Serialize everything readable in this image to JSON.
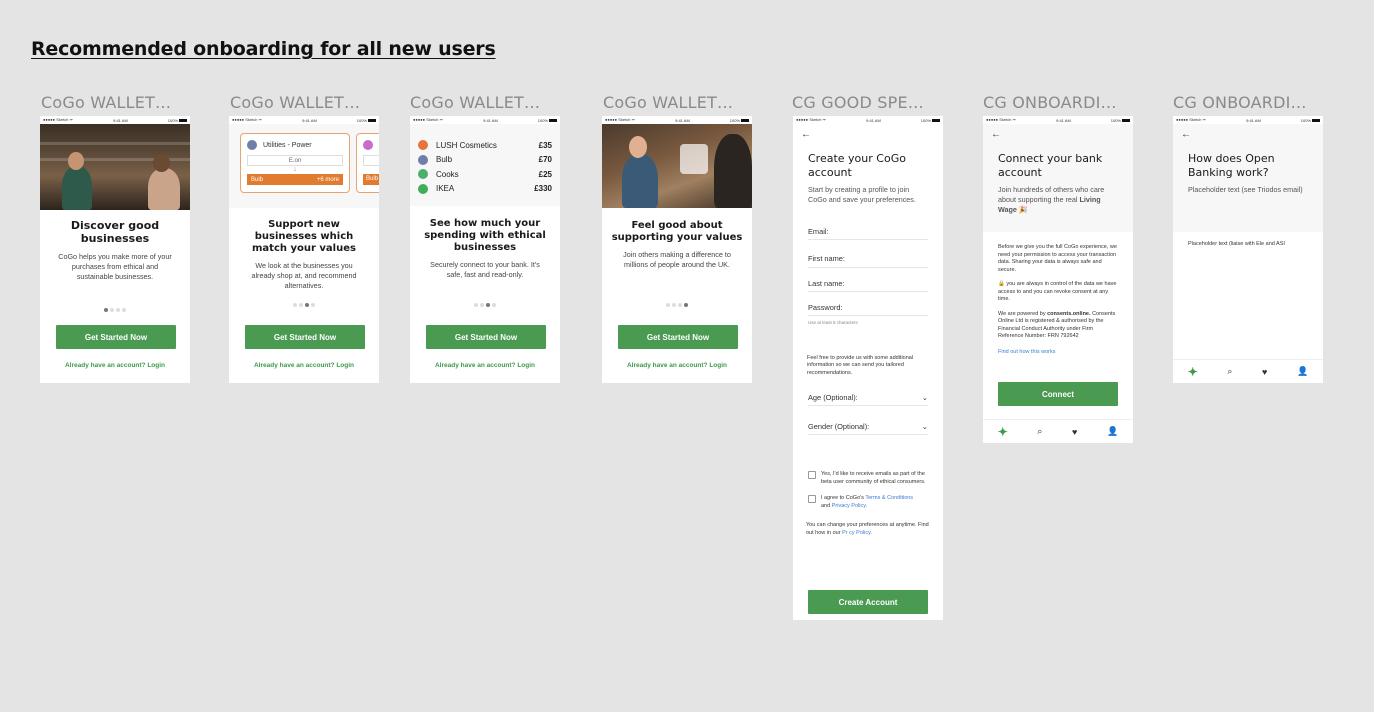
{
  "page_title": "Recommended onboarding for all new users",
  "status": {
    "carrier": "●●●●● Sketch ᯤ",
    "time": "9:41 AM",
    "battery": "100%"
  },
  "common": {
    "cta": "Get Started Now",
    "login": "Already have an account? Login"
  },
  "screens": [
    {
      "label": "CoGo WALLET…",
      "title": "Discover good businesses",
      "body": "CoGo helps you make more of your purchases from ethical and sustainable businesses."
    },
    {
      "label": "CoGo WALLET…",
      "title": "Support new businesses which match your values",
      "body": "We look at the businesses you already shop at, and recommend alternatives.",
      "card": {
        "category": "Utilities - Power",
        "current": "E.on",
        "suggestion": "Bulb",
        "more": "+6 more",
        "peek": "Bulb"
      }
    },
    {
      "label": "CoGo WALLET…",
      "title": "See how much your spending with ethical businesses",
      "body": "Securely connect to your bank. It's safe, fast and read-only.",
      "merchants": [
        {
          "name": "LUSH Cosmetics",
          "amount": "£35",
          "color": "#e8743b"
        },
        {
          "name": "Bulb",
          "amount": "£70",
          "color": "#6f7fa8"
        },
        {
          "name": "Cooks",
          "amount": "£25",
          "color": "#4cb06a"
        },
        {
          "name": "IKEA",
          "amount": "£330",
          "color": "#3fae5a"
        }
      ]
    },
    {
      "label": "CoGo WALLET…",
      "title": "Feel good about supporting your values",
      "body": "Join others making a difference to millions of people around the UK."
    },
    {
      "label": "CG GOOD SPE…",
      "back": "←",
      "title": "Create your CoGo account",
      "sub": "Start by creating a profile to join CoGo and save your preferences.",
      "fields": [
        "Email:",
        "First name:",
        "Last name:",
        "Password:"
      ],
      "password_hint": "Use at least 8 characters",
      "extra_info": "Feel free to provide us with some additional information so we can send you tailored recommendations.",
      "selects": [
        "Age (Optional):",
        "Gender (Optional):"
      ],
      "check1": "Yes, I'd like to receive emails as part of the beta user community of ethical consumers.",
      "check2_pre": "I agree to CoGo's",
      "check2_terms": "Terms & Conditions",
      "check2_and": "and",
      "check2_privacy": "Privacy Policy.",
      "prefs_note": "You can change your preferences at anytime. Find out how in our",
      "prefs_link": "Pr cy Policy.",
      "button": "Create Account"
    },
    {
      "label": "CG ONBOARDI…",
      "back": "←",
      "title": "Connect your bank account",
      "sub": "Join hundreds of others who care about supporting the real",
      "sub_bold": "Living Wage",
      "p1": "Before we give you the full CoGo experience, we need your permission to access your transaction data. Sharing your data is always safe and secure.",
      "p2": "🔒 you are always in control of the data we have access to and you can revoke consent at any time.",
      "p3_pre": "We are powered by",
      "p3_bold": "consents.online.",
      "p3_post": "Consents Online Ltd is registered & authorised by the Financial Conduct Authority under Firm Reference Number: FRN 792642",
      "link": "Find out how this works",
      "button": "Connect"
    },
    {
      "label": "CG ONBOARDI…",
      "back": "←",
      "title": "How does Open Banking work?",
      "sub": "Placeholder text (see Triodos email)",
      "body": "Placeholder text (liaise with Ele and ASI"
    }
  ],
  "tabs": {
    "home": "✦",
    "search": "⌕",
    "heart": "♥",
    "person": "👤"
  }
}
